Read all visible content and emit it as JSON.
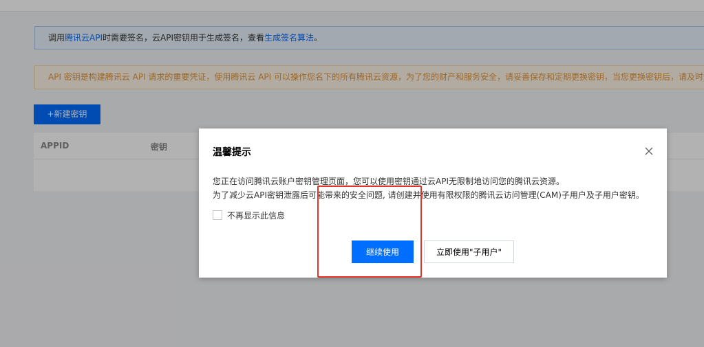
{
  "info_banner": {
    "prefix": "调用",
    "link1": "腾讯云API",
    "middle": "时需要签名，云API密钥用于生成签名，查看",
    "link2": "生成签名算法",
    "suffix": "。"
  },
  "warning_banner": {
    "text": "API 密钥是构建腾讯云 API 请求的重要凭证，使用腾讯云 API 可以操作您名下的所有腾讯云资源，为了您的财产和服务安全，请妥善保存和定期更换密钥，当您更换密钥后，请及时删"
  },
  "toolbar": {
    "new_key_label": "+新建密钥"
  },
  "table": {
    "columns": [
      "APPID",
      "密钥"
    ]
  },
  "dialog": {
    "title": "温馨提示",
    "line1": "您正在访问腾讯云账户密钥管理页面，您可以使用密钥通过云API无限制地访问您的腾讯云资源。",
    "line2": "为了减少云API密钥泄露后可能带来的安全问题, 请创建并使用有限权限的腾讯云访问管理(CAM)子用户及子用户密钥。",
    "checkbox_label": "不再显示此信息",
    "continue_label": "继续使用",
    "subuser_label": "立即使用\"子用户\""
  },
  "colors": {
    "primary": "#006eff",
    "warning_text": "#e0953a",
    "highlight": "#e5342a"
  },
  "icons": {
    "close": "close-icon"
  }
}
